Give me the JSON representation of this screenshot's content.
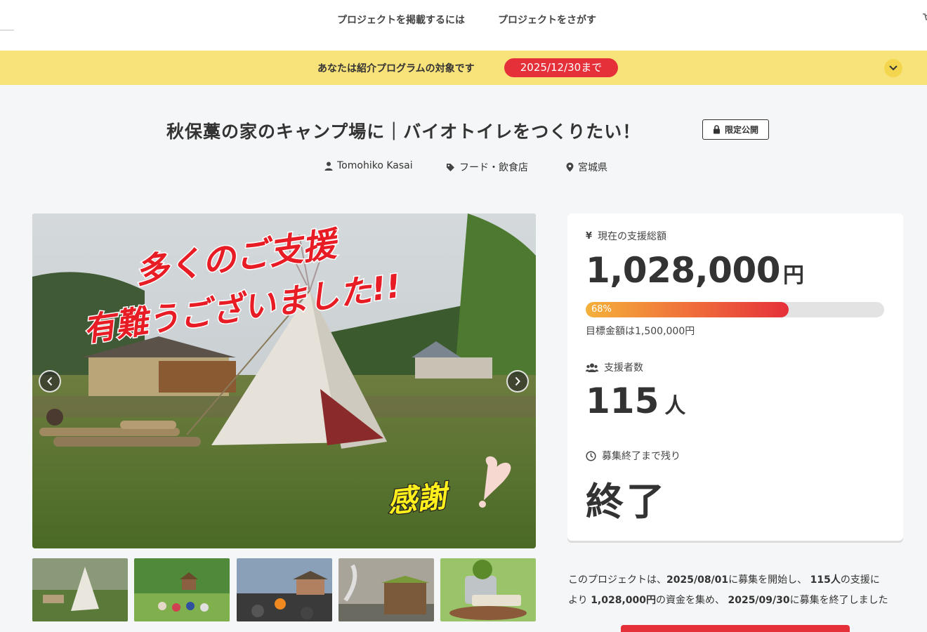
{
  "header": {
    "nav": [
      "プロジェクトを掲載するには",
      "プロジェクトをさがす"
    ]
  },
  "banner": {
    "message": "あなたは紹介プログラムの対象です",
    "deadline": "2025/12/30まで"
  },
  "project": {
    "title": "秋保藁の家のキャンプ場に｜バイオトイレをつくりたい！",
    "visibility": "限定公開",
    "owner": "Tomohiko Kasai",
    "category": "フード・飲食店",
    "location": "宮城県"
  },
  "hero": {
    "overlay_line1": "多くのご支援",
    "overlay_line2": "有難うございました!!",
    "overlay_thanks": "感謝"
  },
  "stats": {
    "raised_label": "現在の支援総額",
    "raised_amount": "1,028,000",
    "currency_unit": "円",
    "progress_label": "68%",
    "progress_percent": 68,
    "goal_text": "目標金額は1,500,000円",
    "backers_label": "支援者数",
    "backers_count": "115",
    "backers_unit": "人",
    "remaining_label": "募集終了まで残り",
    "remaining_value": "終了"
  },
  "summary": {
    "p1": "このプロジェクトは、",
    "start_date": "2025/08/01",
    "p2": "に募集を開始し、",
    "backers": "115人",
    "p3": "の支援に",
    "p4": "より",
    "amount": "1,028,000円",
    "p5": "の資金を集め、",
    "end_date": "2025/09/30",
    "p6": "に募集を終了しました"
  },
  "colors": {
    "accent_red": "#e5303a",
    "banner_yellow": "#f8e27a",
    "progress_start": "#f4b13a"
  }
}
